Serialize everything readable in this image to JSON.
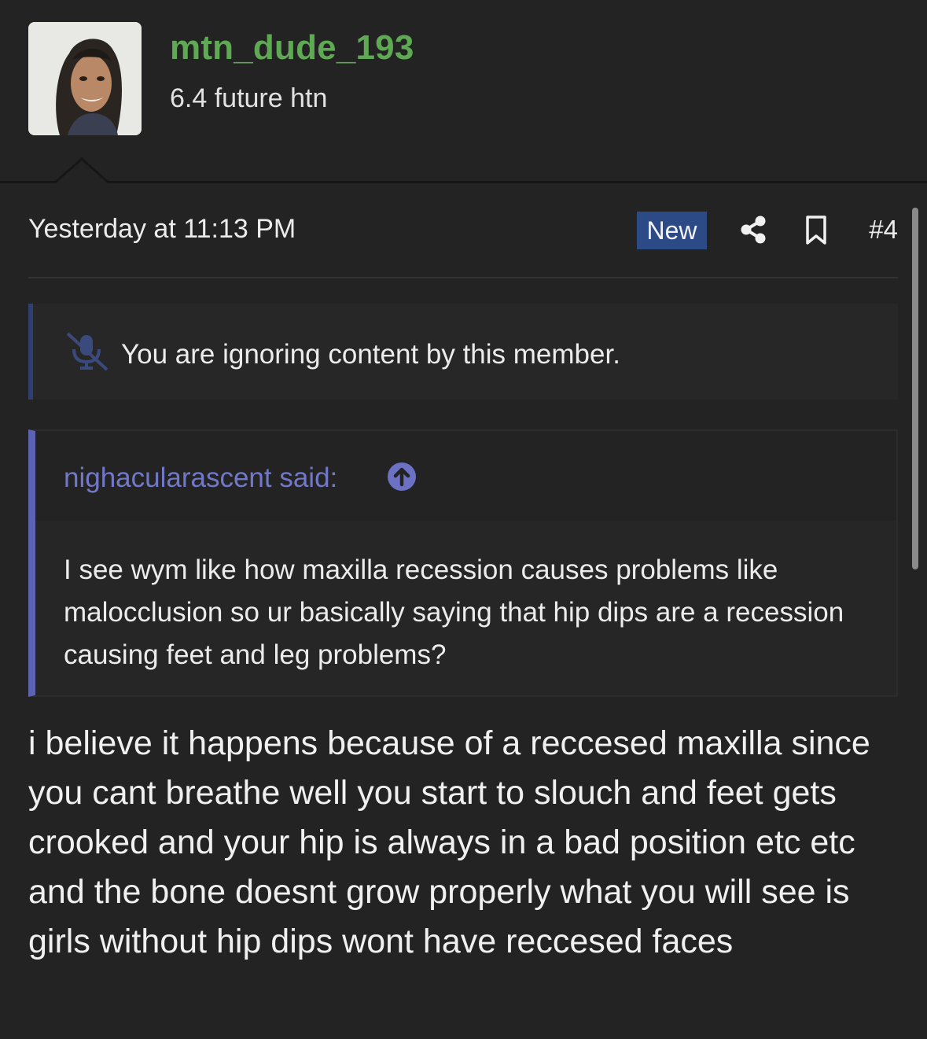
{
  "user": {
    "username": "mtn_dude_193",
    "title": "6.4 future htn",
    "username_color": "#5fa954"
  },
  "post": {
    "timestamp": "Yesterday at 11:13 PM",
    "new_badge": "New",
    "number": "#4",
    "icons": [
      "share-icon",
      "bookmark-icon",
      "mute-icon",
      "arrow-up-circle-icon"
    ],
    "ignore_notice": "You are ignoring content by this member.",
    "quote": {
      "author": "nighacularascent said:",
      "text": "I see wym like how maxilla recession causes problems like malocclusion so ur basically saying that hip dips are a recession causing feet and leg problems?"
    },
    "message": "i believe it happens because of a reccesed maxilla since you cant breathe well you start to slouch and feet gets crooked and your hip is always in a bad position etc etc and the bone doesnt grow properly what you will see is girls without hip dips wont have reccesed faces"
  },
  "colors": {
    "background": "#232323",
    "badge": "#2c4a86",
    "quote_accent": "#5c63b4"
  }
}
